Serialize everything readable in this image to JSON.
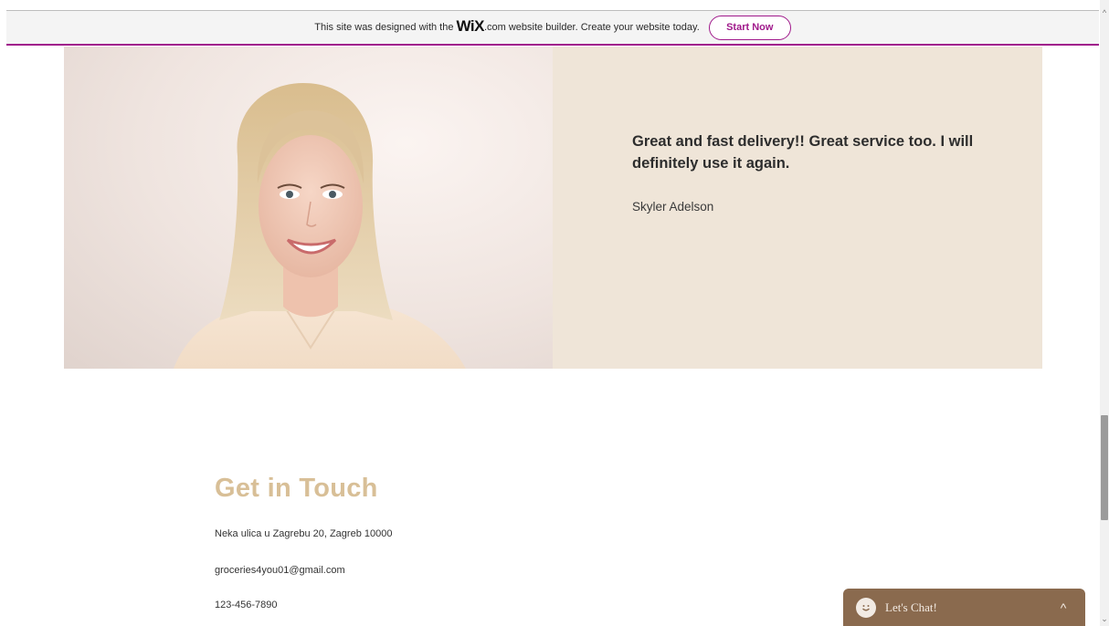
{
  "banner": {
    "text_before": "This site was designed with the",
    "logo": "WiX",
    "text_after": ".com website builder. Create your website today.",
    "button_label": "Start Now",
    "accent_color": "#a0198b"
  },
  "testimonial": {
    "quote": "Great and fast delivery!! Great service too. I will definitely use it again.",
    "author": "Skyler Adelson",
    "image": "smiling-woman-portrait"
  },
  "contact": {
    "title": "Get in Touch",
    "address": "Neka ulica u Zagrebu 20, Zagreb 10000",
    "email": "groceries4you01@gmail.com",
    "phone": "123-456-7890"
  },
  "chat": {
    "label": "Let's Chat!",
    "icon": "smile-icon",
    "toggle_icon": "chevron-up-icon",
    "color": "#8a6a4e"
  }
}
